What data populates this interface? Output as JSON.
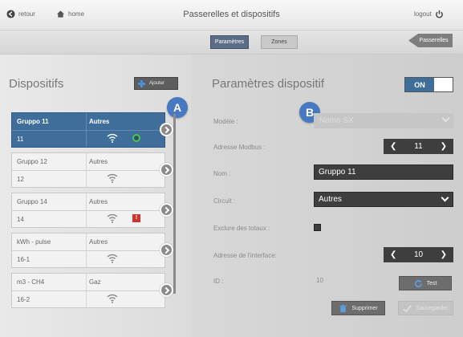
{
  "header": {
    "back_label": "retour",
    "home_label": "home",
    "title": "Passerelles et dispositifs",
    "logout_label": "logout"
  },
  "tabs": {
    "parametres": "Paramètres",
    "zones": "Zones",
    "passerelles": "Passerelles"
  },
  "devices": {
    "title": "Dispositifs",
    "add_label": "Ajouter",
    "items": [
      {
        "name": "Gruppo 11",
        "type": "Autres",
        "id": "11",
        "status": "ok",
        "selected": true
      },
      {
        "name": "Gruppo 12",
        "type": "Autres",
        "id": "12",
        "status": "none",
        "selected": false
      },
      {
        "name": "Gruppo 14",
        "type": "Autres",
        "id": "14",
        "status": "error",
        "status_text": "!",
        "selected": false
      },
      {
        "name": "kWh - pulse",
        "type": "Autres",
        "id": "16-1",
        "status": "none",
        "selected": false
      },
      {
        "name": "m3 - CH4",
        "type": "Gaz",
        "id": "16-2",
        "status": "none",
        "selected": false
      }
    ]
  },
  "badges": {
    "a": "A",
    "b": "B"
  },
  "settings": {
    "title": "Paramètres dispositif",
    "toggle_label": "ON",
    "modele_label": "Modèle :",
    "modele_value": "Nemo SX",
    "modbus_label": "Adresse Modbus :",
    "modbus_value": "11",
    "nom_label": "Nom :",
    "nom_value": "Gruppo 11",
    "circuit_label": "Circuit :",
    "circuit_value": "Autres",
    "exclure_label": "Exclure des totaux :",
    "interface_label": "Adresse de l'interface:",
    "interface_value": "10",
    "id_label": "ID :",
    "id_value": "10",
    "test_label": "Test",
    "delete_label": "Supprimer",
    "save_label": "Sauvegarder"
  },
  "colors": {
    "accent": "#3f6e9a",
    "badge": "#4778c2",
    "ok": "#4fc44f",
    "error": "#d0322d"
  },
  "icons": [
    "back-arrow-icon",
    "home-icon",
    "power-icon",
    "plus-icon",
    "wifi-icon",
    "chevron-right-icon",
    "refresh-icon",
    "trash-icon",
    "save-icon"
  ]
}
